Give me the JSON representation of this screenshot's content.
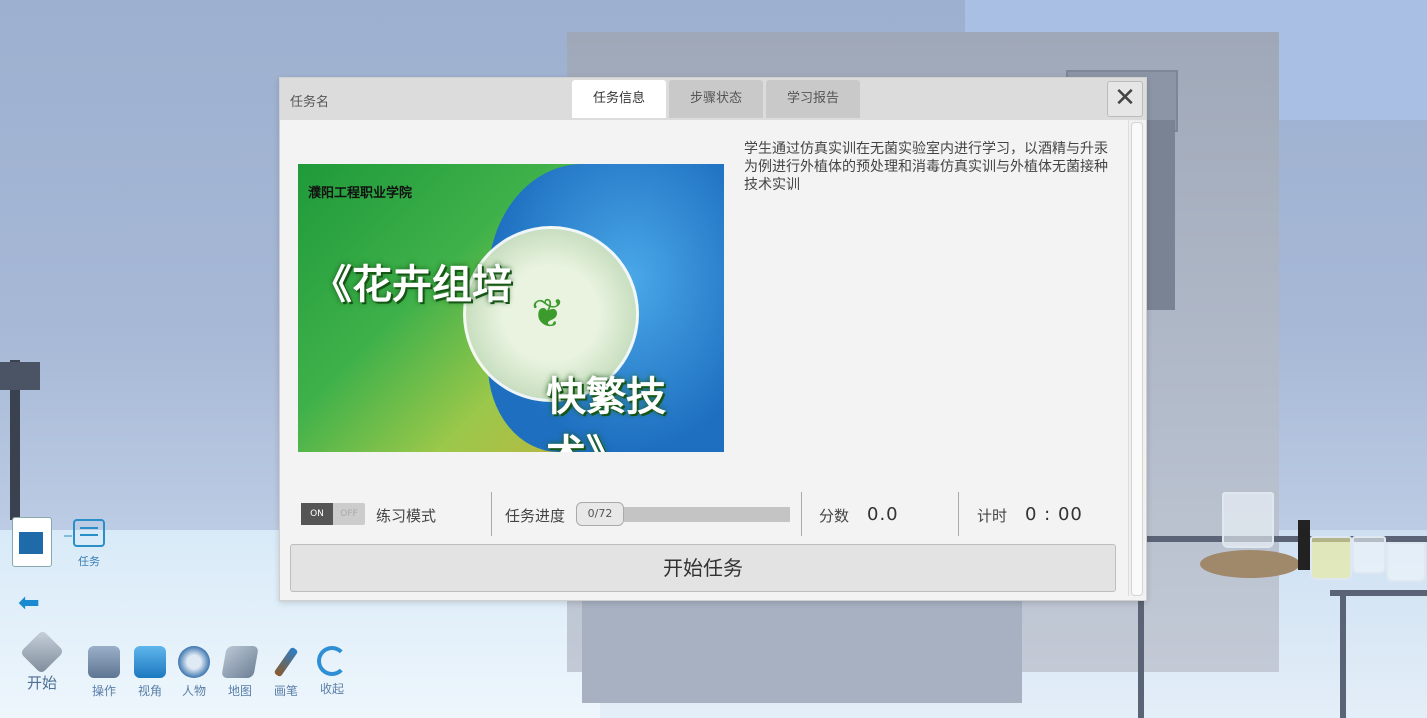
{
  "hud": {
    "task_label": "任务",
    "toolbar": [
      {
        "label": "开始",
        "icon": "start-icon"
      },
      {
        "label": "操作",
        "icon": "operation-icon"
      },
      {
        "label": "视角",
        "icon": "view-angle-icon"
      },
      {
        "label": "人物",
        "icon": "character-icon"
      },
      {
        "label": "地图",
        "icon": "map-icon"
      },
      {
        "label": "画笔",
        "icon": "brush-icon"
      },
      {
        "label": "收起",
        "icon": "collapse-icon"
      }
    ]
  },
  "dialog": {
    "title": "任务名",
    "tabs": [
      "任务信息",
      "步骤状态",
      "学习报告"
    ],
    "active_tab": "任务信息",
    "close_symbol": "✕",
    "image": {
      "school": "濮阳工程职业学院",
      "title_line1": "《花卉组培",
      "title_line2": "快繁技术》"
    },
    "description": "学生通过仿真实训在无菌实验室内进行学习，以酒精与升汞为例进行外植体的预处理和消毒仿真实训与外植体无菌接种技术实训",
    "practice_toggle": {
      "on": "ON",
      "off": "OFF",
      "state": "on"
    },
    "practice_label": "练习模式",
    "progress_label": "任务进度",
    "progress_count": "0/72",
    "progress_fraction": 0.0,
    "score_label": "分数",
    "score_value": "0.0",
    "timer_label": "计时",
    "timer_value": "0 : 00",
    "start_button": "开始任务"
  },
  "colors": {
    "accent": "#1a8ad0",
    "progress_fill": "#5a9a3a"
  }
}
